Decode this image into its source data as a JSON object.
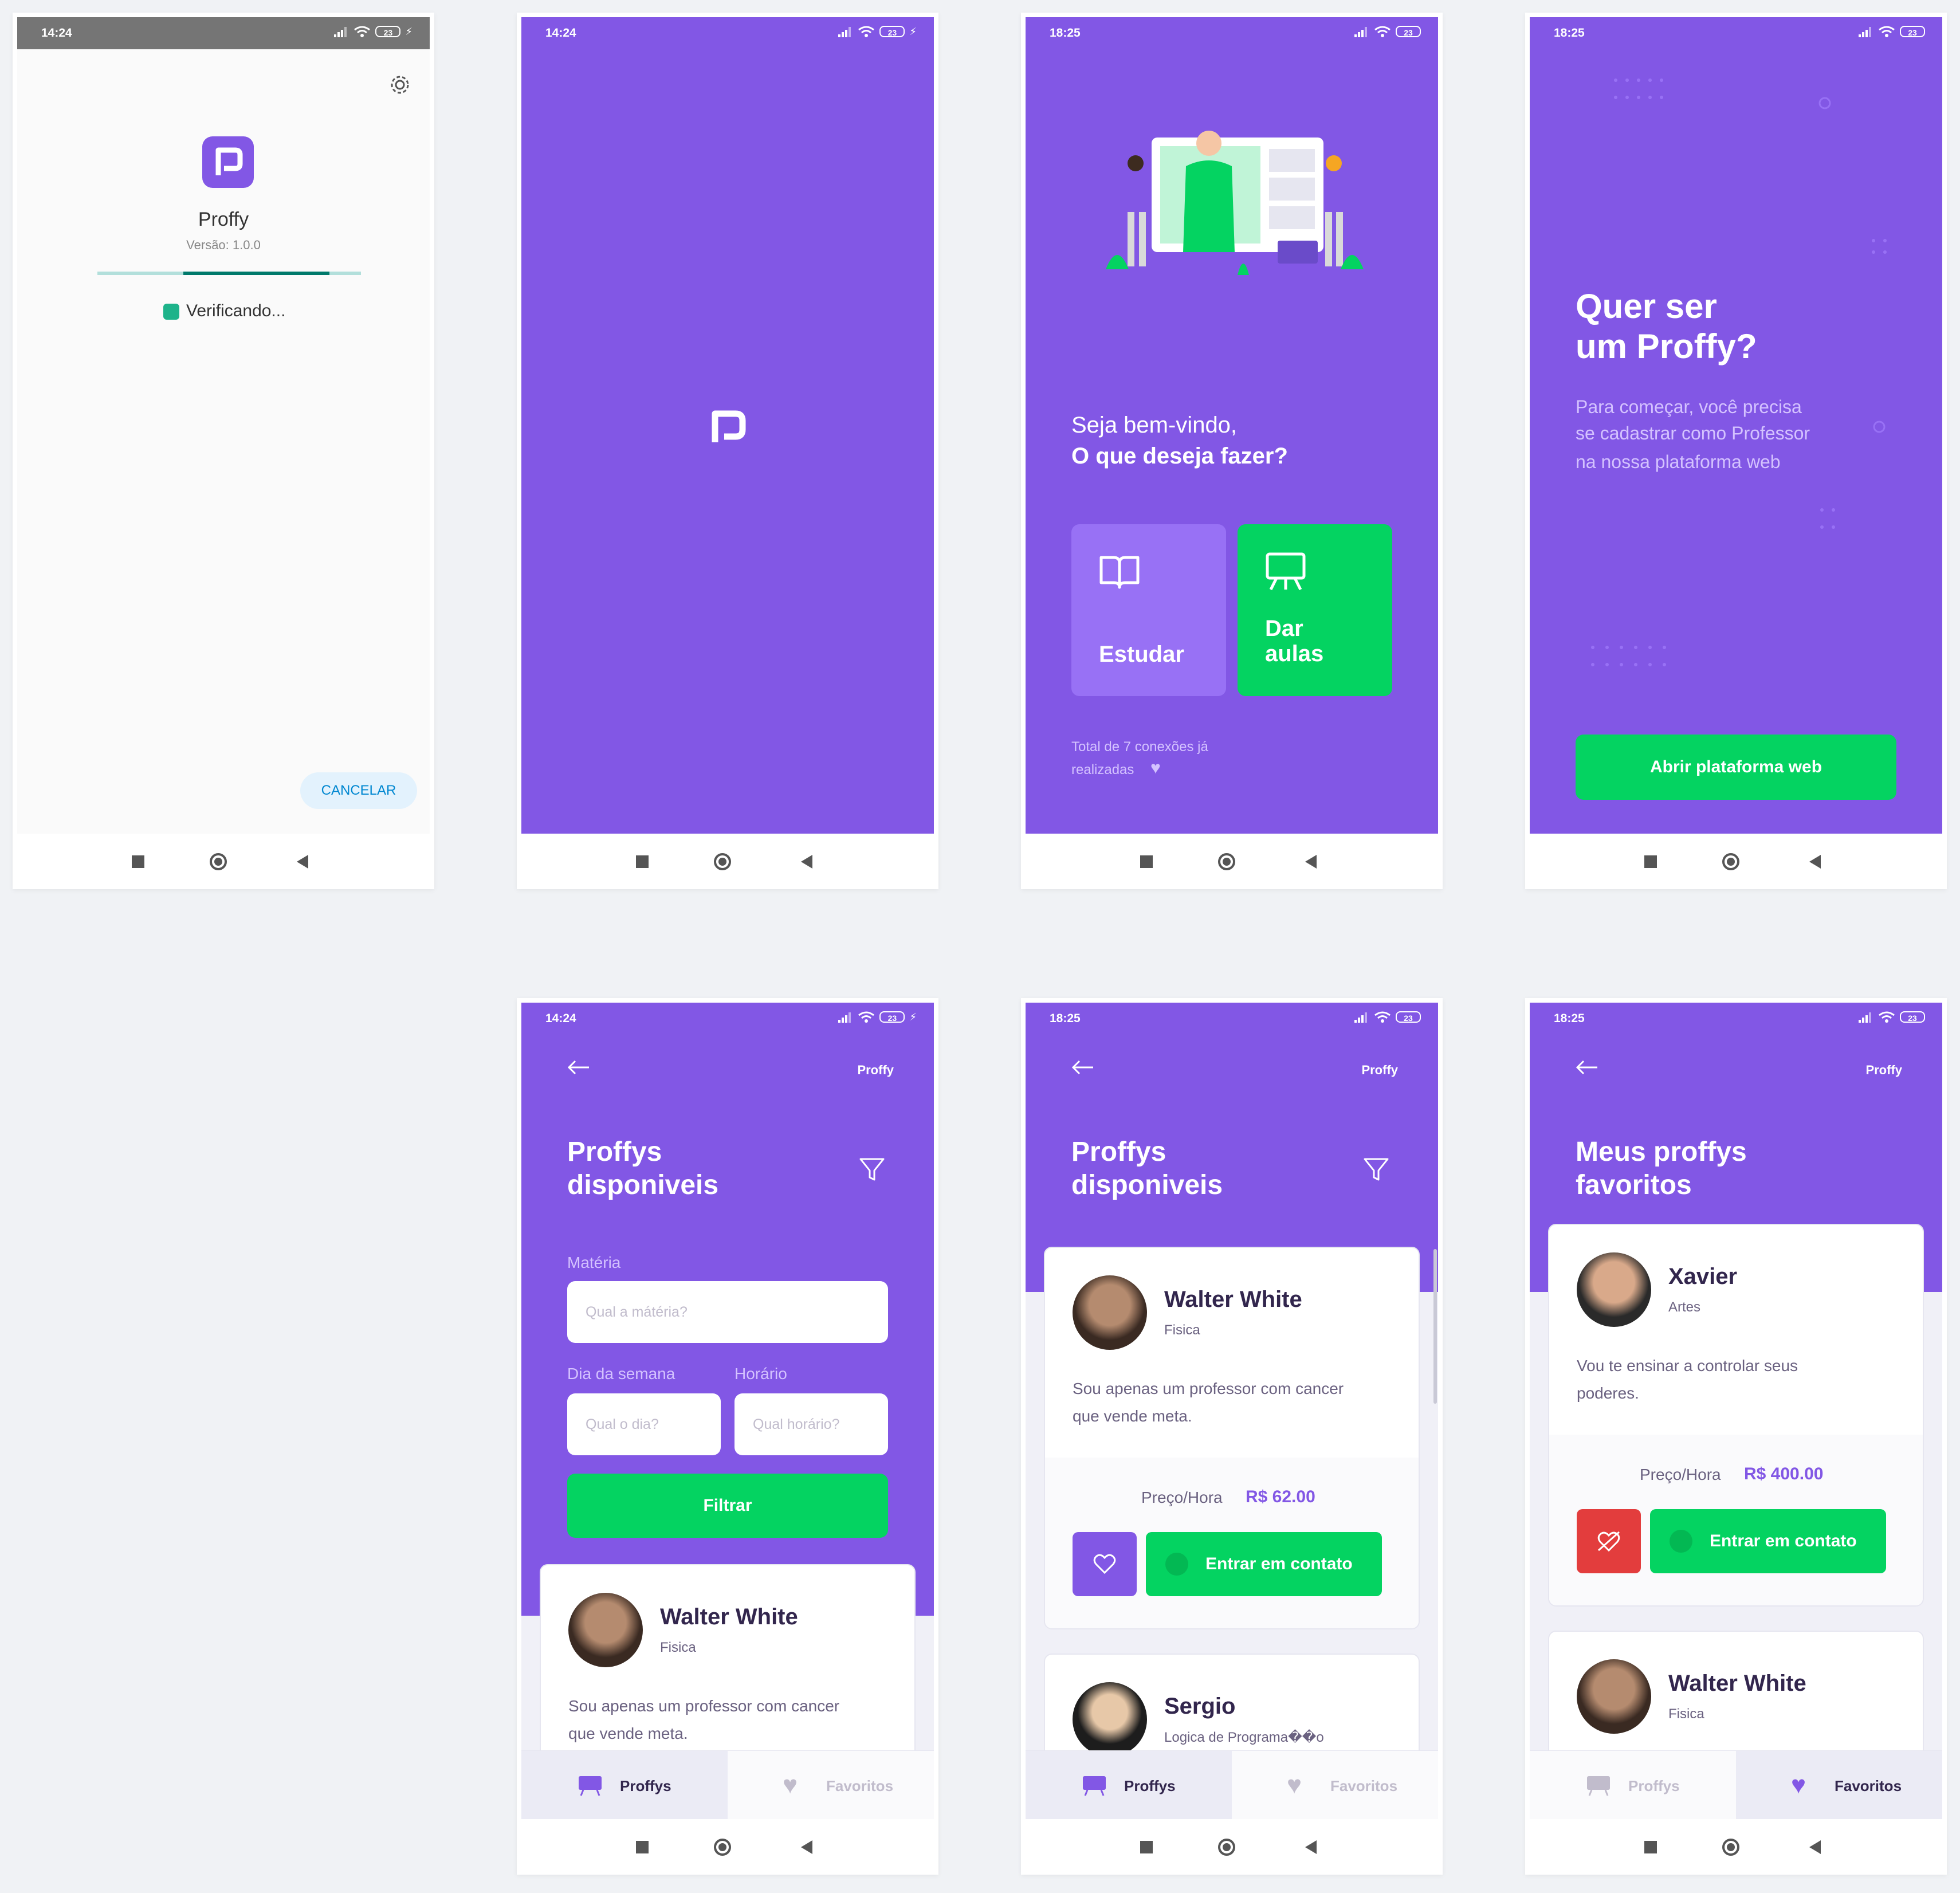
{
  "app": {
    "name": "Proffy"
  },
  "screen1": {
    "time": "14:24",
    "battery": "23",
    "app_name": "Proffy",
    "version": "Versão: 1.0.0",
    "status_text": "Verificando...",
    "cancel_label": "CANCELAR"
  },
  "screen2": {
    "time": "14:24",
    "battery": "23"
  },
  "screen3": {
    "time": "18:25",
    "battery": "23",
    "welcome": "Seja bem-vindo,",
    "question": "O que deseja fazer?",
    "study_label": "Estudar",
    "teach_label_line1": "Dar",
    "teach_label_line2": "aulas",
    "total_line1": "Total de 7 conexões já",
    "total_line2": "realizadas"
  },
  "screen4": {
    "time": "18:25",
    "battery": "23",
    "title_line1": "Quer ser",
    "title_line2": "um Proffy?",
    "desc_line1": "Para começar, você precisa",
    "desc_line2": "se cadastrar como Professor",
    "desc_line3": "na nossa plataforma web",
    "button_label": "Abrir plataforma web"
  },
  "screen5": {
    "time": "14:24",
    "battery": "23",
    "header_label": "Proffy",
    "title_line1": "Proffys",
    "title_line2": "disponiveis",
    "subject_label": "Matéria",
    "subject_placeholder": "Qual a mátéria?",
    "day_label": "Dia da semana",
    "day_placeholder": "Qual o dia?",
    "time_label": "Horário",
    "time_placeholder": "Qual horário?",
    "filter_label": "Filtrar",
    "card": {
      "name": "Walter White",
      "subject": "Fisica",
      "bio_line1": "Sou apenas um professor com cancer",
      "bio_line2": "que vende meta."
    },
    "tabs": {
      "proffys": "Proffys",
      "favoritos": "Favoritos"
    }
  },
  "screen6": {
    "time": "18:25",
    "battery": "23",
    "header_label": "Proffy",
    "title_line1": "Proffys",
    "title_line2": "disponiveis",
    "card1": {
      "name": "Walter White",
      "subject": "Fisica",
      "bio_line1": "Sou apenas um professor com cancer",
      "bio_line2": "que vende meta.",
      "price_label": "Preço/Hora",
      "price_value": "R$ 62.00",
      "contact_label": "Entrar em contato"
    },
    "card2": {
      "name": "Sergio",
      "subject": "Logica de Programa��o"
    },
    "tabs": {
      "proffys": "Proffys",
      "favoritos": "Favoritos"
    }
  },
  "screen7": {
    "time": "18:25",
    "battery": "23",
    "header_label": "Proffy",
    "title_line1": "Meus proffys",
    "title_line2": "favoritos",
    "card1": {
      "name": "Xavier",
      "subject": "Artes",
      "bio_line1": "Vou te ensinar a controlar seus",
      "bio_line2": "poderes.",
      "price_label": "Preço/Hora",
      "price_value": "R$ 400.00",
      "contact_label": "Entrar em contato"
    },
    "card2": {
      "name": "Walter White",
      "subject": "Fisica"
    },
    "tabs": {
      "proffys": "Proffys",
      "favoritos": "Favoritos"
    }
  },
  "colors": {
    "primary": "#8257e5",
    "primary_light": "#9871f5",
    "secondary": "#04d361",
    "danger": "#e33d3d",
    "text_title": "#32264d",
    "text_base": "#6a6180"
  }
}
